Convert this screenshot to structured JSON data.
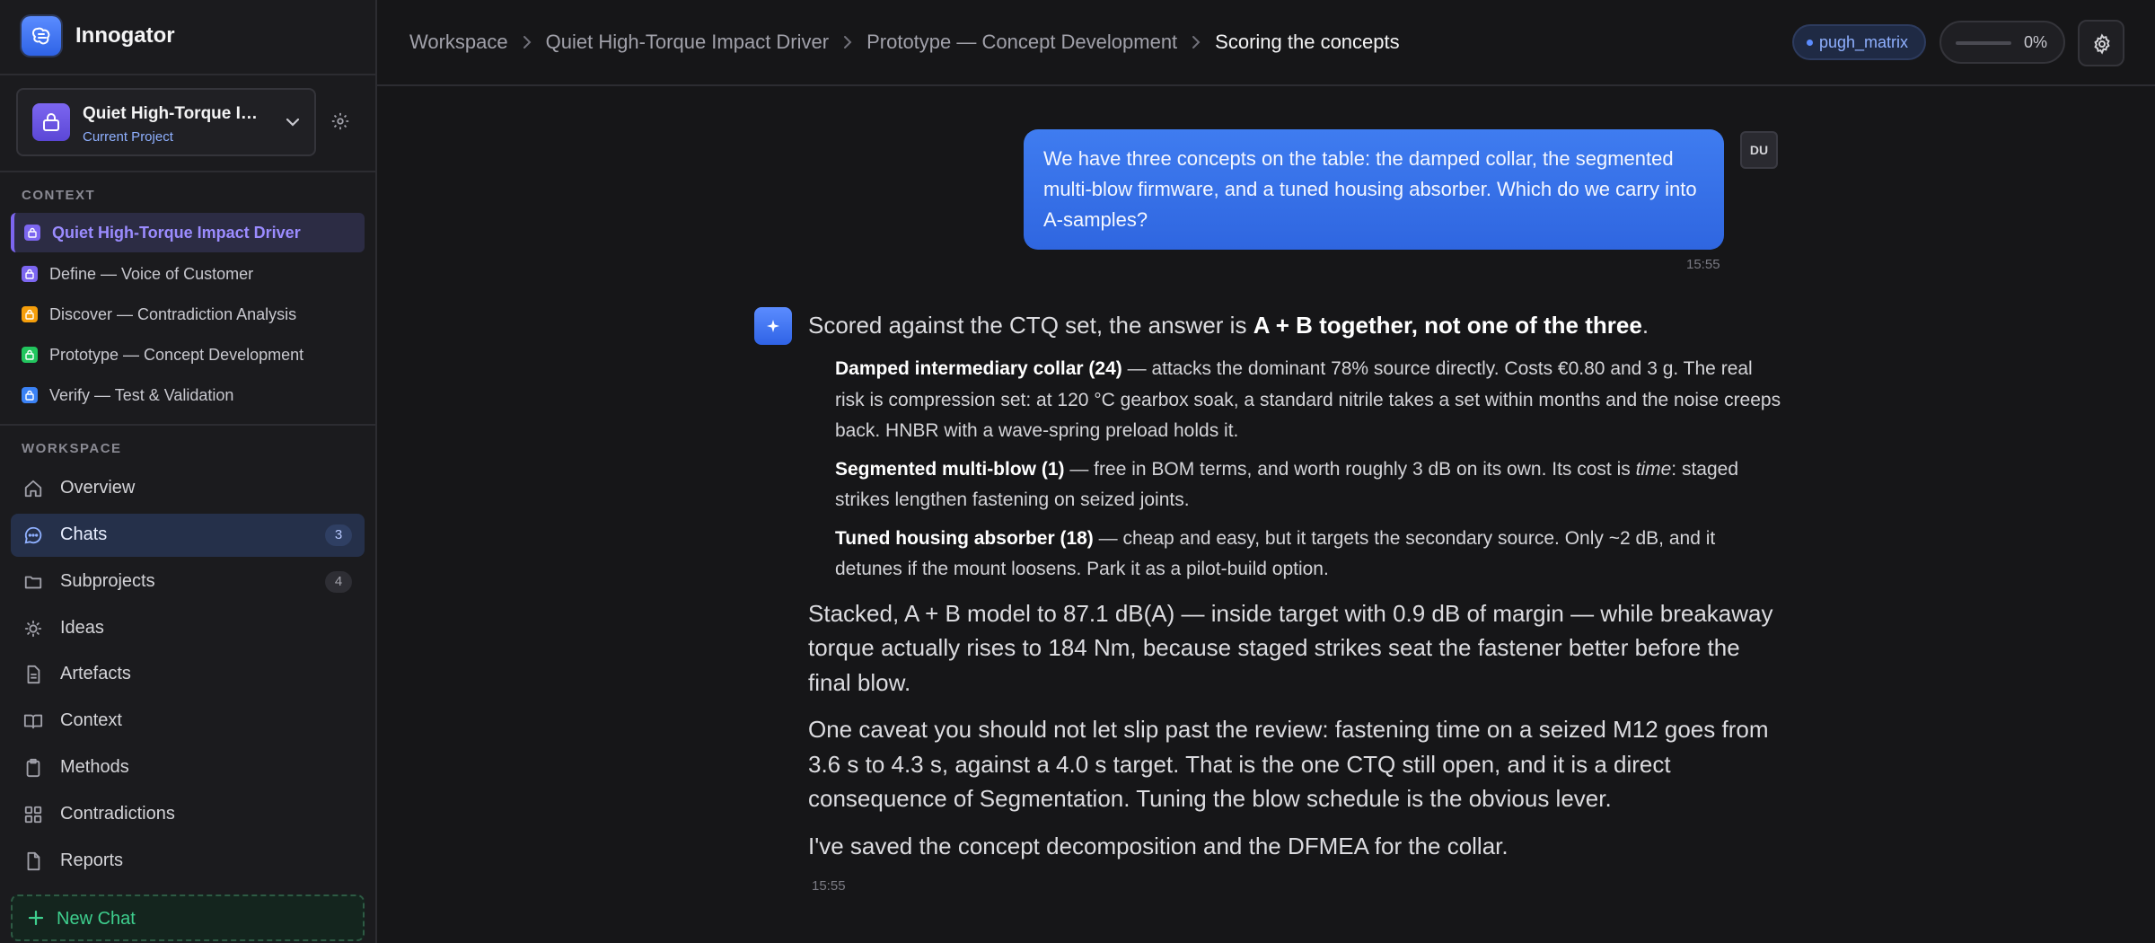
{
  "app": {
    "name": "Innogator"
  },
  "project": {
    "name": "Quiet High-Torque Impact Driver",
    "subtitle": "Current Project"
  },
  "context": {
    "label": "CONTEXT",
    "items": [
      {
        "label": "Quiet High-Torque Impact Driver",
        "color": "#7c66f0"
      },
      {
        "label": "Define — Voice of Customer",
        "color": "#7c66f0"
      },
      {
        "label": "Discover — Contradiction Analysis",
        "color": "#f59e0b"
      },
      {
        "label": "Prototype — Concept Development",
        "color": "#22c55e"
      },
      {
        "label": "Verify — Test & Validation",
        "color": "#3b82f6"
      }
    ]
  },
  "workspace": {
    "label": "WORKSPACE",
    "items": [
      {
        "label": "Overview",
        "icon": "home-icon"
      },
      {
        "label": "Chats",
        "icon": "chat-icon",
        "badge": "3"
      },
      {
        "label": "Subprojects",
        "icon": "folder-icon",
        "badge": "4"
      },
      {
        "label": "Ideas",
        "icon": "lightbulb-icon"
      },
      {
        "label": "Artefacts",
        "icon": "document-icon"
      },
      {
        "label": "Context",
        "icon": "book-icon"
      },
      {
        "label": "Methods",
        "icon": "clipboard-icon"
      },
      {
        "label": "Contradictions",
        "icon": "grid-icon"
      },
      {
        "label": "Reports",
        "icon": "report-icon"
      }
    ],
    "new_chat": "New Chat"
  },
  "breadcrumbs": [
    "Workspace",
    "Quiet High-Torque Impact Driver",
    "Prototype — Concept Development",
    "Scoring the concepts"
  ],
  "header": {
    "tag": "pugh_matrix",
    "progress_text": "0%",
    "progress_value": 0
  },
  "chat": {
    "user": {
      "avatar": "DU",
      "text": "We have three concepts on the table: the damped collar, the segmented multi-blow firmware, and a tuned housing absorber. Which do we carry into A-samples?",
      "time": "15:55"
    },
    "assistant": {
      "lead_pre": "Scored against the CTQ set, the answer is ",
      "lead_bold": "A + B together, not one of the three",
      "lead_post": ".",
      "items": [
        {
          "title": "Damped intermediary collar (24)",
          "text": " — attacks the dominant 78% source directly. Costs €0.80 and 3 g. The real risk is compression set: at 120 °C gearbox soak, a standard nitrile takes a set within months and the noise creeps back. HNBR with a wave-spring preload holds it."
        },
        {
          "title": "Segmented multi-blow (1)",
          "text_pre": " — free in BOM terms, and worth roughly 3 dB on its own. Its cost is ",
          "text_em": "time",
          "text_post": ": staged strikes lengthen fastening on seized joints."
        },
        {
          "title": "Tuned housing absorber (18)",
          "text": " — cheap and easy, but it targets the secondary source. Only ~2 dB, and it detunes if the mount loosens. Park it as a pilot-build option."
        }
      ],
      "p1": "Stacked, A + B model to 87.1 dB(A) — inside target with 0.9 dB of margin — while breakaway torque actually rises to 184 Nm, because staged strikes seat the fastener better before the final blow.",
      "p2": "One caveat you should not let slip past the review: fastening time on a seized M12 goes from 3.6 s to 4.3 s, against a 4.0 s target. That is the one CTQ still open, and it is a direct consequence of Segmentation. Tuning the blow schedule is the obvious lever.",
      "p3": "I've saved the concept decomposition and the DFMEA for the collar.",
      "time": "15:55"
    }
  }
}
